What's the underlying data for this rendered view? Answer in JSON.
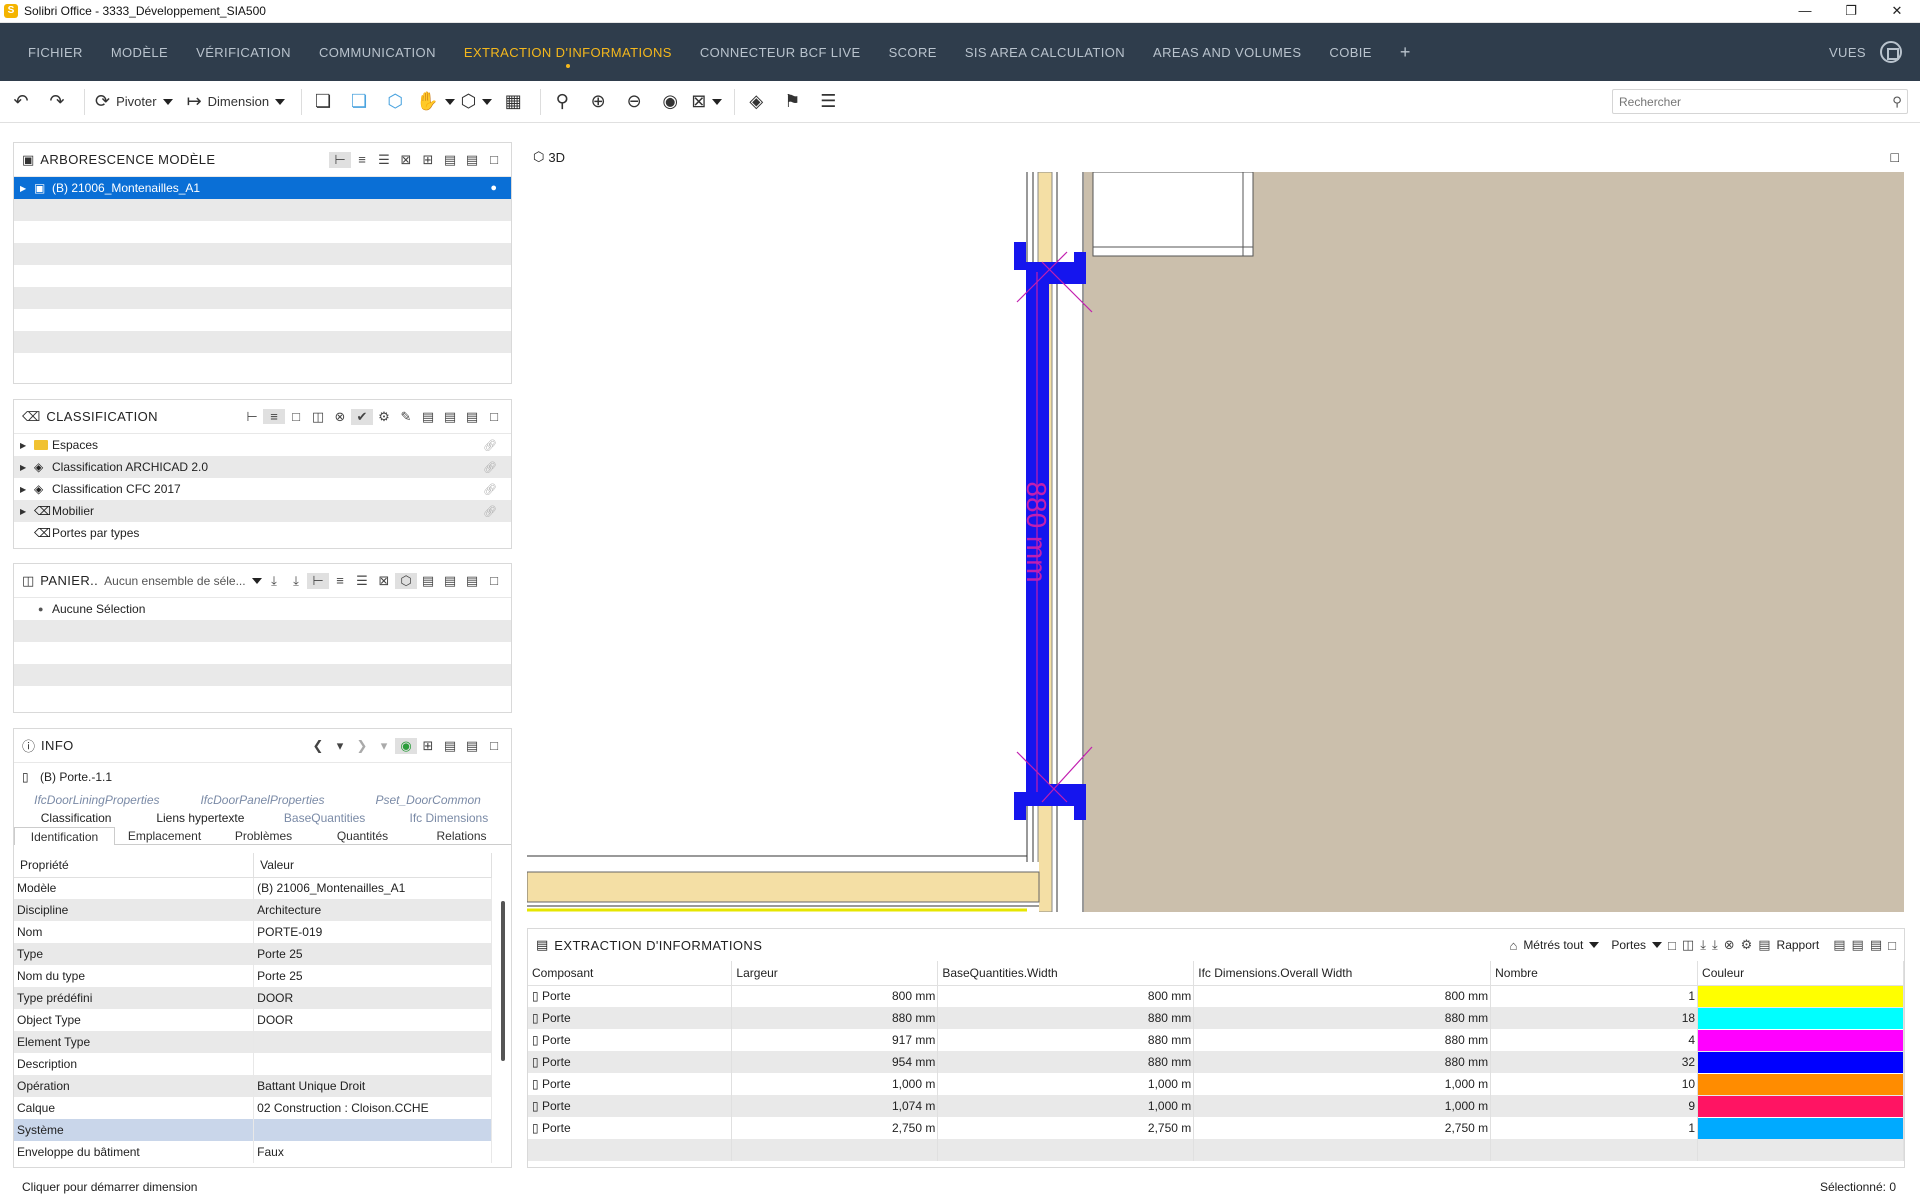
{
  "window": {
    "title": "Solibri Office - 3333_Développement_SIA500",
    "app_icon": "S"
  },
  "menu": {
    "items": [
      "FICHIER",
      "MODÈLE",
      "VÉRIFICATION",
      "COMMUNICATION",
      "EXTRACTION D'INFORMATIONS",
      "CONNECTEUR BCF LIVE",
      "SCORE",
      "SIS AREA CALCULATION",
      "AREAS AND VOLUMES",
      "COBIE"
    ],
    "active_index": 4,
    "add": "+",
    "views": "VUES"
  },
  "toolbar": {
    "rotate_label": "Pivoter",
    "dimension_label": "Dimension",
    "search_placeholder": "Rechercher"
  },
  "model_tree": {
    "title": "ARBORESCENCE MODÈLE",
    "items": [
      {
        "label": "(B) 21006_Montenailles_A1",
        "selected": true
      }
    ]
  },
  "classification": {
    "title": "CLASSIFICATION",
    "items": [
      {
        "label": "Espaces",
        "icon": "folder-icon"
      },
      {
        "label": "Classification ARCHICAD 2.0",
        "icon": "classification-icon"
      },
      {
        "label": "Classification CFC 2017",
        "icon": "classification-icon"
      },
      {
        "label": "Mobilier",
        "icon": "tag-icon"
      },
      {
        "label": "Portes par types",
        "icon": "tag-icon"
      }
    ]
  },
  "basket": {
    "title": "PANIER..",
    "selector": "Aucun ensemble de séle...",
    "items": [
      {
        "label": "Aucune Sélection"
      }
    ]
  },
  "info": {
    "title": "INFO",
    "selected": "(B) Porte.-1.1",
    "tabs_top": [
      "IfcDoorLiningProperties",
      "IfcDoorPanelProperties",
      "Pset_DoorCommon"
    ],
    "tabs_mid": [
      "Classification",
      "Liens hypertexte",
      "BaseQuantities",
      "Ifc Dimensions"
    ],
    "tabs_bot": [
      "Identification",
      "Emplacement",
      "Problèmes",
      "Quantités",
      "Relations"
    ],
    "col_property": "Propriété",
    "col_value": "Valeur",
    "properties": [
      {
        "name": "Modèle",
        "value": "(B) 21006_Montenailles_A1"
      },
      {
        "name": "Discipline",
        "value": "Architecture"
      },
      {
        "name": "Nom",
        "value": "PORTE-019"
      },
      {
        "name": "Type",
        "value": "Porte 25"
      },
      {
        "name": "Nom du type",
        "value": "Porte 25"
      },
      {
        "name": "Type prédéfini",
        "value": "DOOR"
      },
      {
        "name": "Object Type",
        "value": "DOOR"
      },
      {
        "name": "Element Type",
        "value": ""
      },
      {
        "name": "Description",
        "value": ""
      },
      {
        "name": "Opération",
        "value": "Battant Unique Droit"
      },
      {
        "name": "Calque",
        "value": "02 Construction : Cloison.CCHE"
      },
      {
        "name": "Système",
        "value": ""
      },
      {
        "name": "Enveloppe du bâtiment",
        "value": "Faux"
      }
    ]
  },
  "viewport": {
    "label": "3D",
    "dimension_text": "880 mm"
  },
  "extraction": {
    "title": "EXTRACTION D'INFORMATIONS",
    "measure_all": "Métrés tout",
    "doors_dropdown": "Portes",
    "report": "Rapport",
    "columns": [
      "Composant",
      "Largeur",
      "BaseQuantities.Width",
      "Ifc Dimensions.Overall Width",
      "Nombre",
      "Couleur"
    ],
    "rows": [
      {
        "component": "Porte",
        "width": "800 mm",
        "base_width": "800 mm",
        "overall_width": "800 mm",
        "count": "1",
        "color": "#ffff00"
      },
      {
        "component": "Porte",
        "width": "880 mm",
        "base_width": "880 mm",
        "overall_width": "880 mm",
        "count": "18",
        "color": "#00ffff"
      },
      {
        "component": "Porte",
        "width": "917 mm",
        "base_width": "880 mm",
        "overall_width": "880 mm",
        "count": "4",
        "color": "#ff00ff"
      },
      {
        "component": "Porte",
        "width": "954 mm",
        "base_width": "880 mm",
        "overall_width": "880 mm",
        "count": "32",
        "color": "#0000ff"
      },
      {
        "component": "Porte",
        "width": "1,000 m",
        "base_width": "1,000 m",
        "overall_width": "1,000 m",
        "count": "10",
        "color": "#ff8c00"
      },
      {
        "component": "Porte",
        "width": "1,074 m",
        "base_width": "1,000 m",
        "overall_width": "1,000 m",
        "count": "9",
        "color": "#ff1463"
      },
      {
        "component": "Porte",
        "width": "2,750 m",
        "base_width": "2,750 m",
        "overall_width": "2,750 m",
        "count": "1",
        "color": "#00aaff"
      }
    ]
  },
  "status": {
    "hint": "Cliquer pour démarrer dimension",
    "selected": "Sélectionné: 0"
  },
  "colors": {
    "menubar": "#2f3d4c",
    "menu_active": "#f5b81c",
    "selection": "#0a6fd6",
    "door_blue": "#1515ee",
    "dimension_magenta": "#c21fb0",
    "wall_fill": "#f4dfa5",
    "room_fill": "#cbbfac"
  }
}
